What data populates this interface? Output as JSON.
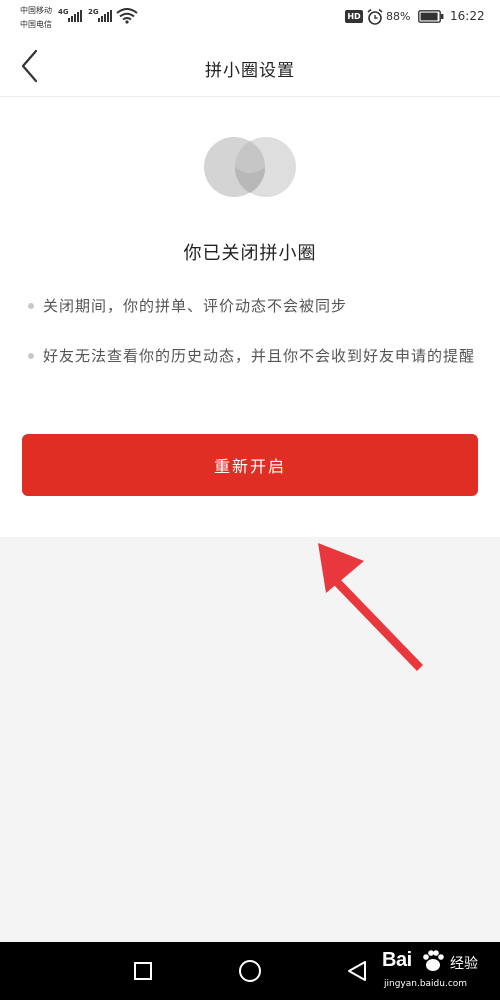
{
  "status_bar": {
    "carrier_1": "中国移动",
    "carrier_2": "中国电信",
    "network_1": "4G",
    "network_2": "2G",
    "hd_badge": "HD",
    "battery": "88%",
    "time": "16:22",
    "icons": [
      "signal-icon",
      "wifi-icon",
      "alarm-icon",
      "battery-icon"
    ]
  },
  "header": {
    "title": "拼小圈设置",
    "back_icon": "chevron-left-icon"
  },
  "main": {
    "status_title": "你已关闭拼小圈",
    "bullets": [
      "关闭期间，你的拼单、评价动态不会被同步",
      "好友无法查看你的历史动态，并且你不会收到好友申请的提醒"
    ],
    "reopen_button": "重新开启"
  },
  "system_nav": {
    "icons": [
      "recent-apps-icon",
      "home-icon",
      "back-triangle-icon"
    ]
  },
  "watermark": {
    "logo": "Bai",
    "jingyan": "经验",
    "url": "jingyan.baidu.com"
  },
  "colors": {
    "accent": "#e02e24",
    "annotation_arrow": "#e8383d",
    "background": "#f4f4f4",
    "card": "#ffffff"
  }
}
